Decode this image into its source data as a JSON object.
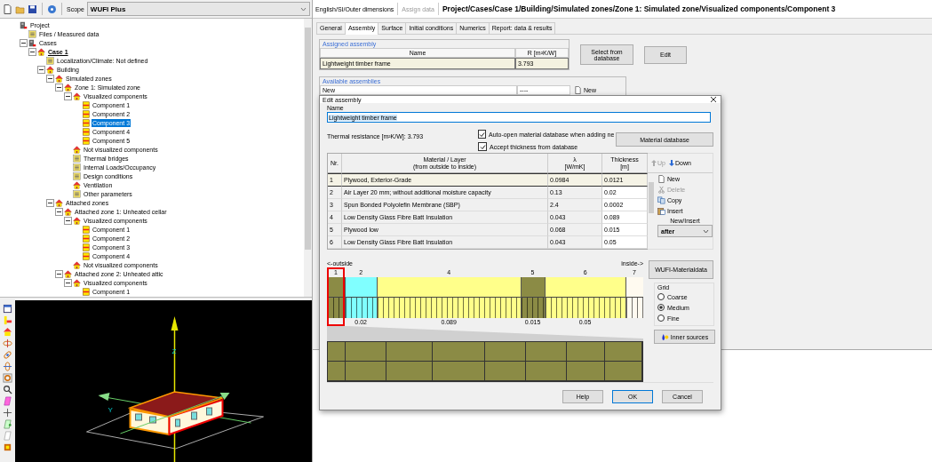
{
  "toolbar": {
    "scope_label": "Scope",
    "scope_value": "WUFI Plus"
  },
  "tree": [
    {
      "label": "Project",
      "kind": "project",
      "selected": false,
      "children": [
        {
          "label": "Files / Measured data",
          "kind": "setting",
          "selected": false
        },
        {
          "label": "Cases",
          "kind": "project",
          "selected": false,
          "expanded": true,
          "children": [
            {
              "label": "Case 1",
              "kind": "case",
              "selected": false,
              "expanded": true,
              "children": [
                {
                  "label": "Localization/Climate: Not defined",
                  "kind": "setting",
                  "selected": false
                },
                {
                  "label": "Building",
                  "kind": "group",
                  "selected": false,
                  "expanded": true,
                  "children": [
                    {
                      "label": "Simulated zones",
                      "kind": "group",
                      "selected": false,
                      "expanded": true,
                      "children": [
                        {
                          "label": "Zone 1: Simulated zone",
                          "kind": "group",
                          "selected": false,
                          "expanded": true,
                          "children": [
                            {
                              "label": "Visualized components",
                              "kind": "group",
                              "selected": false,
                              "expanded": true,
                              "children": [
                                {
                                  "label": "Component 1",
                                  "kind": "component",
                                  "selected": false
                                },
                                {
                                  "label": "Component 2",
                                  "kind": "component",
                                  "selected": false
                                },
                                {
                                  "label": "Component 3",
                                  "kind": "component",
                                  "selected": true
                                },
                                {
                                  "label": "Component 4",
                                  "kind": "component",
                                  "selected": false
                                },
                                {
                                  "label": "Component 5",
                                  "kind": "component",
                                  "selected": false
                                }
                              ]
                            },
                            {
                              "label": "Not visualized components",
                              "kind": "group",
                              "selected": false
                            },
                            {
                              "label": "Thermal bridges",
                              "kind": "setting",
                              "selected": false
                            },
                            {
                              "label": "Internal Loads/Occupancy",
                              "kind": "setting",
                              "selected": false
                            },
                            {
                              "label": "Design conditions",
                              "kind": "setting",
                              "selected": false
                            },
                            {
                              "label": "Ventilation",
                              "kind": "group",
                              "selected": false
                            },
                            {
                              "label": "Other parameters",
                              "kind": "setting",
                              "selected": false
                            }
                          ]
                        }
                      ]
                    },
                    {
                      "label": "Attached zones",
                      "kind": "group",
                      "selected": false,
                      "expanded": true,
                      "children": [
                        {
                          "label": "Attached zone 1: Unheated cellar",
                          "kind": "group",
                          "selected": false,
                          "expanded": true,
                          "children": [
                            {
                              "label": "Visualized components",
                              "kind": "group",
                              "selected": false,
                              "expanded": true,
                              "children": [
                                {
                                  "label": "Component 1",
                                  "kind": "component",
                                  "selected": false
                                },
                                {
                                  "label": "Component 2",
                                  "kind": "component",
                                  "selected": false
                                },
                                {
                                  "label": "Component 3",
                                  "kind": "component",
                                  "selected": false
                                },
                                {
                                  "label": "Component 4",
                                  "kind": "component",
                                  "selected": false
                                }
                              ]
                            },
                            {
                              "label": "Not visualized components",
                              "kind": "group",
                              "selected": false
                            }
                          ]
                        },
                        {
                          "label": "Attached zone 2: Unheated attic",
                          "kind": "group",
                          "selected": false,
                          "expanded": true,
                          "children": [
                            {
                              "label": "Visualized components",
                              "kind": "group",
                              "selected": false,
                              "expanded": true,
                              "children": [
                                {
                                  "label": "Component 1",
                                  "kind": "component",
                                  "selected": false
                                }
                              ]
                            }
                          ]
                        }
                      ]
                    }
                  ]
                }
              ]
            }
          ]
        }
      ]
    }
  ],
  "view": {
    "axis_labels": [
      "Z",
      "Y"
    ]
  },
  "header": {
    "units": "English/SI/Outer dimensions",
    "assign": "Assign data",
    "assign_disabled": true,
    "path": "Project/Cases/Case 1/Building/Simulated zones/Zone 1: Simulated zone/Visualized components/Component 3"
  },
  "tabs": [
    {
      "label": "General",
      "selected": false
    },
    {
      "label": "Assembly",
      "selected": true
    },
    {
      "label": "Surface",
      "selected": false
    },
    {
      "label": "Initial conditions",
      "selected": false
    },
    {
      "label": "Numerics",
      "selected": false
    },
    {
      "label": "Report: data & results",
      "selected": false
    }
  ],
  "assigned": {
    "title": "Assigned assembly",
    "columns": [
      "Name",
      "R [m²K/W]"
    ],
    "row": [
      "Lightweight timber frame",
      "3.793"
    ]
  },
  "assign_buttons": [
    "Select from database",
    "Edit"
  ],
  "available": {
    "title": "Available assemblies",
    "row": [
      "New",
      "----"
    ],
    "button": "New"
  },
  "dialog": {
    "title": "Edit assembly",
    "name_label": "Name",
    "name_value": "Lightweight timber frame",
    "thermal": "Thermal resistance  [m²K/W]: 3.793",
    "checks": [
      {
        "label": "Auto-open material database when adding ne",
        "checked": true
      },
      {
        "label": "Accept thickness from database",
        "checked": true
      }
    ],
    "material_db": "Material database",
    "columns": [
      {
        "title": "Nr."
      },
      {
        "title": "Material / Layer",
        "unit": "(from outside to inside)"
      },
      {
        "title": "λ",
        "unit": "[W/mK]"
      },
      {
        "title": "Thickness",
        "unit": "[m]"
      }
    ],
    "move": [
      {
        "label": "Up",
        "disabled": true
      },
      {
        "label": "Down",
        "disabled": false
      }
    ],
    "rows": [
      {
        "nr": "1",
        "material": "Plywood, Exterior-Grade",
        "lambda": "0.0984",
        "thickness": "0.0121",
        "selected": true
      },
      {
        "nr": "2",
        "material": "Air Layer 20 mm; without additional moisture capacity",
        "lambda": "0.13",
        "thickness": "0.02",
        "selected": false
      },
      {
        "nr": "3",
        "material": "Spun Bonded Polyolefin Membrane (SBP)",
        "lambda": "2.4",
        "thickness": "0.0002",
        "selected": false
      },
      {
        "nr": "4",
        "material": "Low Density Glass Fibre Batt Insulation",
        "lambda": "0.043",
        "thickness": "0.089",
        "selected": false
      },
      {
        "nr": "5",
        "material": "Plywood low",
        "lambda": "0.068",
        "thickness": "0.015",
        "selected": false
      },
      {
        "nr": "6",
        "material": "Low Density Glass Fibre Batt Insulation",
        "lambda": "0.043",
        "thickness": "0.05",
        "selected": false
      }
    ],
    "actions": [
      {
        "kind": "new",
        "label": "New",
        "disabled": false
      },
      {
        "kind": "delete",
        "label": "Delete",
        "disabled": true
      },
      {
        "kind": "copy",
        "label": "Copy",
        "disabled": false
      },
      {
        "kind": "insert",
        "label": "Insert",
        "disabled": false
      }
    ],
    "insert_label": "New/Insert",
    "insert_value": "after",
    "outside": "<-outside",
    "inside": "inside->",
    "layers": [
      {
        "number": "1",
        "color": "#8b8b45",
        "selected": true
      },
      {
        "number": "2",
        "color": "#80ffff",
        "thickness": "0.02",
        "selected": false
      },
      {
        "number": "4",
        "color": "#ffff8a",
        "thickness": "0.089",
        "selected": false
      },
      {
        "number": "5",
        "color": "#8b8b45",
        "thickness": "0.015",
        "selected": false
      },
      {
        "number": "6",
        "color": "#ffff8a",
        "thickness": "0.05",
        "selected": false
      },
      {
        "number": "7",
        "color": "#fffaf0",
        "selected": false
      }
    ],
    "materialdata": "WUFI-Materialdata",
    "grid": {
      "title": "Grid",
      "options": [
        {
          "label": "Coarse",
          "selected": false
        },
        {
          "label": "Medium",
          "selected": true
        },
        {
          "label": "Fine",
          "selected": false
        }
      ]
    },
    "inner_sources": "Inner sources",
    "buttons": [
      {
        "label": "Help",
        "default": false
      },
      {
        "label": "OK",
        "default": true
      },
      {
        "label": "Cancel",
        "default": false
      }
    ]
  }
}
